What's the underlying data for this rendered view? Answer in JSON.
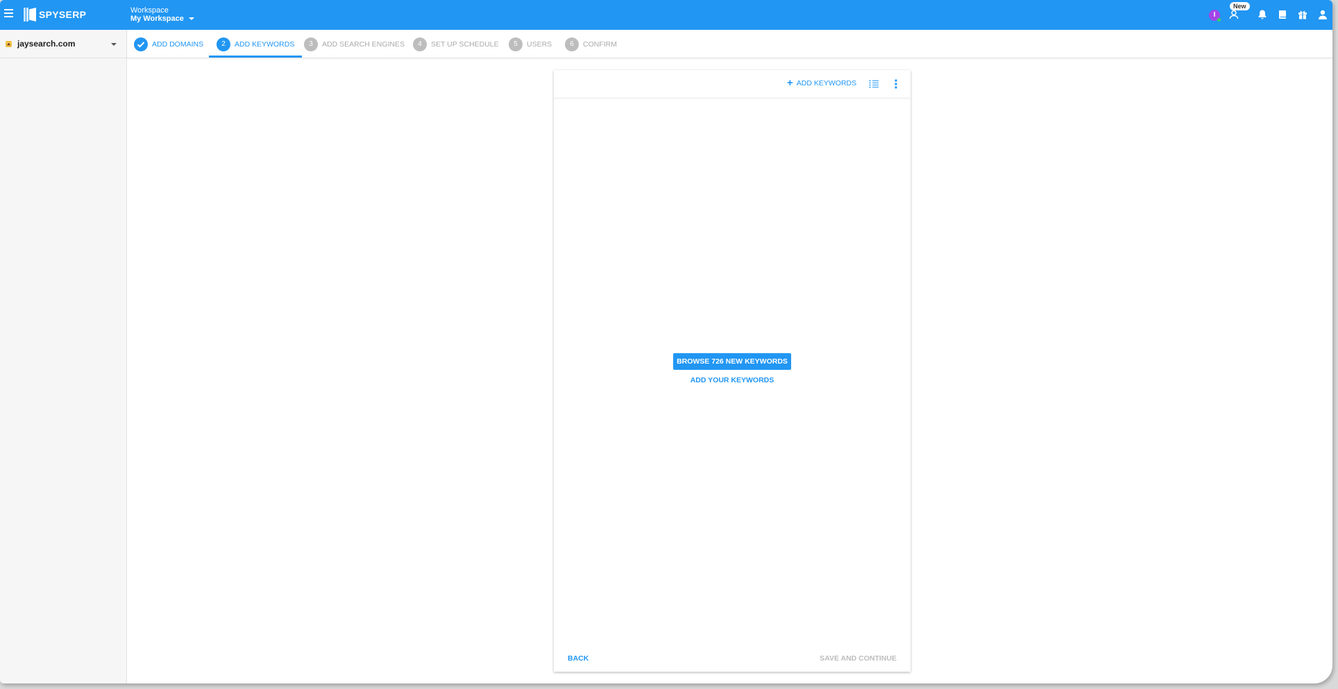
{
  "app": {
    "logo_text": "SPYSERP",
    "workspace_label": "Workspace",
    "workspace_name": "My Workspace",
    "new_badge": "New",
    "avatar_initial": "I",
    "icons": [
      "menu-icon",
      "logo-icon",
      "users-new-icon",
      "bell-icon",
      "book-icon",
      "gift-icon",
      "account-icon"
    ],
    "colors": {
      "primary": "#2196f3",
      "avatar": "#a445e8",
      "online": "#3fd45a"
    }
  },
  "sidebar": {
    "site": "jaysearch.com"
  },
  "stepper": {
    "steps": [
      {
        "num": "1",
        "label": "ADD DOMAINS",
        "state": "done"
      },
      {
        "num": "2",
        "label": "ADD KEYWORDS",
        "state": "active"
      },
      {
        "num": "3",
        "label": "ADD SEARCH ENGINES",
        "state": "pending"
      },
      {
        "num": "4",
        "label": "SET UP SCHEDULE",
        "state": "pending"
      },
      {
        "num": "5",
        "label": "USERS",
        "state": "pending"
      },
      {
        "num": "6",
        "label": "CONFIRM",
        "state": "pending"
      }
    ]
  },
  "card": {
    "add_keywords_label": "ADD KEYWORDS",
    "browse_button": "BROWSE 726 NEW KEYWORDS",
    "add_your_keywords": "ADD YOUR KEYWORDS",
    "back": "BACK",
    "save_and_continue": "SAVE AND CONTINUE"
  }
}
